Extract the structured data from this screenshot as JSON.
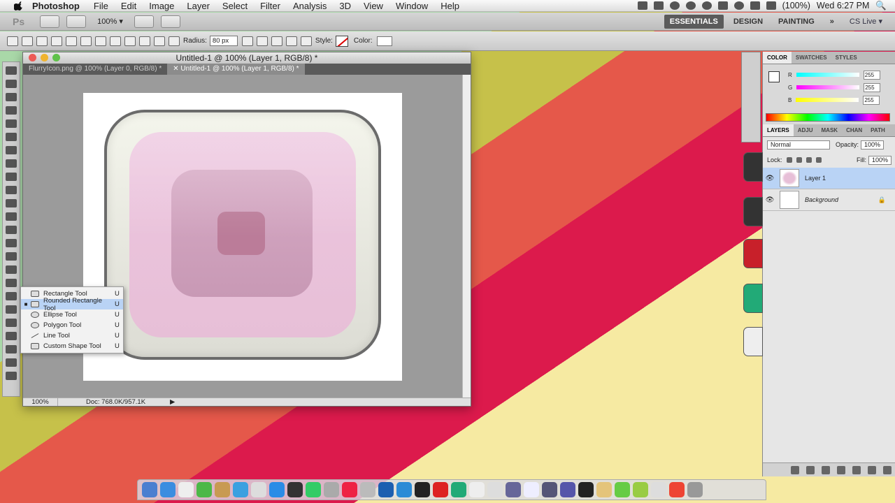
{
  "menubar": {
    "app_name": "Photoshop",
    "menus": [
      "File",
      "Edit",
      "Image",
      "Layer",
      "Select",
      "Filter",
      "Analysis",
      "3D",
      "View",
      "Window",
      "Help"
    ],
    "battery": "(100%)",
    "clock": "Wed 6:27 PM"
  },
  "appbar": {
    "logo": "Ps",
    "zoom": "100% ▾",
    "workspaces": [
      "ESSENTIALS",
      "DESIGN",
      "PAINTING"
    ],
    "more": "»",
    "cs_live": "CS Live ▾"
  },
  "options": {
    "radius_label": "Radius:",
    "radius_value": "80 px",
    "style_label": "Style:",
    "color_label": "Color:"
  },
  "document": {
    "title": "Untitled-1 @ 100% (Layer 1, RGB/8) *",
    "tabs": [
      "FlurryIcon.png @ 100% (Layer 0, RGB/8) *",
      "✕ Untitled-1 @ 100% (Layer 1, RGB/8) *"
    ],
    "zoom": "100%",
    "doc_info": "Doc: 768.0K/957.1K"
  },
  "flyout": {
    "items": [
      {
        "label": "Rectangle Tool",
        "key": "U",
        "selected": false,
        "icon": "rectangle-icon"
      },
      {
        "label": "Rounded Rectangle Tool",
        "key": "U",
        "selected": true,
        "icon": "rounded-rectangle-icon"
      },
      {
        "label": "Ellipse Tool",
        "key": "U",
        "selected": false,
        "icon": "ellipse-icon"
      },
      {
        "label": "Polygon Tool",
        "key": "U",
        "selected": false,
        "icon": "polygon-icon"
      },
      {
        "label": "Line Tool",
        "key": "U",
        "selected": false,
        "icon": "line-icon"
      },
      {
        "label": "Custom Shape Tool",
        "key": "U",
        "selected": false,
        "icon": "custom-shape-icon"
      }
    ]
  },
  "color_panel": {
    "tabs": [
      "COLOR",
      "SWATCHES",
      "STYLES"
    ],
    "channels": [
      {
        "name": "R",
        "value": "255"
      },
      {
        "name": "G",
        "value": "255"
      },
      {
        "name": "B",
        "value": "255"
      }
    ]
  },
  "layers_panel": {
    "tabs": [
      "LAYERS",
      "ADJU",
      "MASK",
      "CHAN",
      "PATH"
    ],
    "blend_mode": "Normal",
    "opacity_label": "Opacity:",
    "opacity_value": "100%",
    "lock_label": "Lock:",
    "fill_label": "Fill:",
    "fill_value": "100%",
    "layers": [
      {
        "name": "Layer 1",
        "active": true
      },
      {
        "name": "Background",
        "active": false
      }
    ]
  },
  "colors": {
    "accent": "#b9d3f5"
  }
}
